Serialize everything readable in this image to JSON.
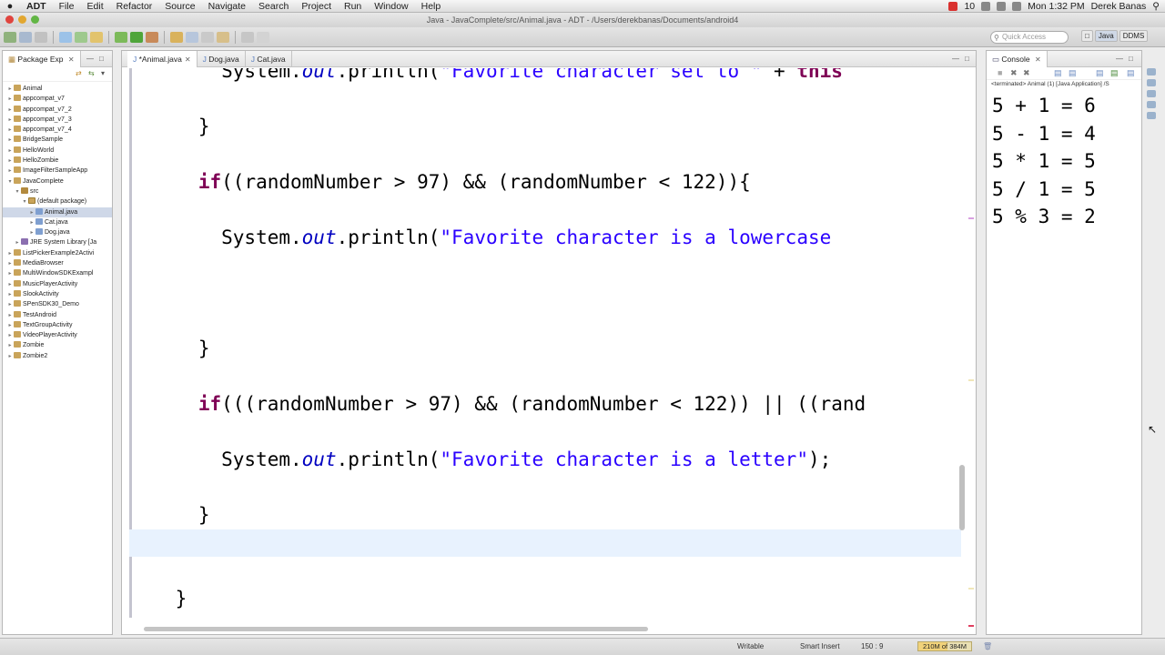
{
  "menubar": {
    "app": "ADT",
    "items": [
      "File",
      "Edit",
      "Refactor",
      "Source",
      "Navigate",
      "Search",
      "Project",
      "Run",
      "Window",
      "Help"
    ],
    "battery_count": "10",
    "clock": "Mon 1:32 PM",
    "user": "Derek Banas"
  },
  "window": {
    "title": "Java - JavaComplete/src/Animal.java - ADT - /Users/derekbanas/Documents/android4"
  },
  "toolbar": {
    "quick_access_placeholder": "Quick Access",
    "perspectives": [
      "Java",
      "DDMS"
    ]
  },
  "package_explorer": {
    "tab_label": "Package Exp",
    "tree": [
      {
        "label": "Animal",
        "type": "proj",
        "indent": 0,
        "twisty": "▸"
      },
      {
        "label": "appcompat_v7",
        "type": "proj",
        "indent": 0,
        "twisty": "▸"
      },
      {
        "label": "appcompat_v7_2",
        "type": "proj",
        "indent": 0,
        "twisty": "▸"
      },
      {
        "label": "appcompat_v7_3",
        "type": "proj",
        "indent": 0,
        "twisty": "▸"
      },
      {
        "label": "appcompat_v7_4",
        "type": "proj",
        "indent": 0,
        "twisty": "▸"
      },
      {
        "label": "BridgeSample",
        "type": "proj",
        "indent": 0,
        "twisty": "▸"
      },
      {
        "label": "HelloWorld",
        "type": "proj",
        "indent": 0,
        "twisty": "▸"
      },
      {
        "label": "HelloZombie",
        "type": "proj",
        "indent": 0,
        "twisty": "▸"
      },
      {
        "label": "ImageFilterSampleApp",
        "type": "proj",
        "indent": 0,
        "twisty": "▸"
      },
      {
        "label": "JavaComplete",
        "type": "proj",
        "indent": 0,
        "twisty": "▾"
      },
      {
        "label": "src",
        "type": "src",
        "indent": 1,
        "twisty": "▾"
      },
      {
        "label": "(default package)",
        "type": "pkgi",
        "indent": 2,
        "twisty": "▾"
      },
      {
        "label": "Animal.java",
        "type": "jfile",
        "indent": 3,
        "twisty": "▸",
        "selected": true
      },
      {
        "label": "Cat.java",
        "type": "jfile",
        "indent": 3,
        "twisty": "▸"
      },
      {
        "label": "Dog.java",
        "type": "jfile",
        "indent": 3,
        "twisty": "▸"
      },
      {
        "label": "JRE System Library [Ja",
        "type": "lib",
        "indent": 1,
        "twisty": "▸"
      },
      {
        "label": "ListPickerExample2Activi",
        "type": "proj",
        "indent": 0,
        "twisty": "▸"
      },
      {
        "label": "MediaBrowser",
        "type": "proj",
        "indent": 0,
        "twisty": "▸"
      },
      {
        "label": "MultiWindowSDKExampl",
        "type": "proj",
        "indent": 0,
        "twisty": "▸"
      },
      {
        "label": "MusicPlayerActivity",
        "type": "proj",
        "indent": 0,
        "twisty": "▸"
      },
      {
        "label": "SlookActivity",
        "type": "proj",
        "indent": 0,
        "twisty": "▸"
      },
      {
        "label": "SPenSDK30_Demo",
        "type": "proj",
        "indent": 0,
        "twisty": "▸"
      },
      {
        "label": "TestAndroid",
        "type": "proj",
        "indent": 0,
        "twisty": "▸"
      },
      {
        "label": "TextGroupActivity",
        "type": "proj",
        "indent": 0,
        "twisty": "▸"
      },
      {
        "label": "VideoPlayerActivity",
        "type": "proj",
        "indent": 0,
        "twisty": "▸"
      },
      {
        "label": "Zombie",
        "type": "proj",
        "indent": 0,
        "twisty": "▸"
      },
      {
        "label": "Zombie2",
        "type": "proj",
        "indent": 0,
        "twisty": "▸"
      }
    ]
  },
  "editor": {
    "tabs": [
      {
        "label": "*Animal.java",
        "active": true
      },
      {
        "label": "Dog.java",
        "active": false
      },
      {
        "label": "Cat.java",
        "active": false
      }
    ],
    "lines": [
      {
        "tokens": [
          [
            "",
            "        System."
          ],
          [
            "it",
            "out"
          ],
          [
            "",
            ".println("
          ],
          [
            "str",
            "\"Favorite character set to \""
          ],
          [
            "",
            " + "
          ],
          [
            "kw",
            "this"
          ]
        ]
      },
      {
        "tokens": [
          [
            "",
            "      }"
          ]
        ]
      },
      {
        "tokens": [
          [
            "",
            "      "
          ],
          [
            "kw",
            "if"
          ],
          [
            "",
            "((randomNumber > 97) && (randomNumber < 122)){"
          ]
        ]
      },
      {
        "tokens": [
          [
            "",
            "        System."
          ],
          [
            "it",
            "out"
          ],
          [
            "",
            ".println("
          ],
          [
            "str",
            "\"Favorite character is a lowercase"
          ]
        ]
      },
      {
        "tokens": []
      },
      {
        "tokens": [
          [
            "",
            "      }"
          ]
        ]
      },
      {
        "tokens": [
          [
            "",
            "      "
          ],
          [
            "kw",
            "if"
          ],
          [
            "",
            "(((randomNumber > 97) && (randomNumber < 122)) || ((rand"
          ]
        ]
      },
      {
        "tokens": [
          [
            "",
            "        System."
          ],
          [
            "it",
            "out"
          ],
          [
            "",
            ".println("
          ],
          [
            "str",
            "\"Favorite character is a letter\""
          ],
          [
            "",
            ");"
          ]
        ]
      },
      {
        "tokens": [
          [
            "",
            "      }"
          ]
        ]
      },
      {
        "tokens": [],
        "current": true
      },
      {
        "tokens": [
          [
            "",
            "    }"
          ]
        ]
      }
    ]
  },
  "console": {
    "tab_label": "Console",
    "status": "<terminated> Animal (1) [Java Application] /S",
    "output": [
      "5 + 1 = 6",
      "5 - 1 = 4",
      "5 * 1 = 5",
      "5 / 1 = 5",
      "5 % 3 = 2"
    ]
  },
  "statusbar": {
    "writable": "Writable",
    "insert_mode": "Smart Insert",
    "position": "150 : 9",
    "heap": "210M of 384M",
    "heap_used_fraction": 0.55
  },
  "colors": {
    "keyword": "#7f0055",
    "string": "#2a00ff",
    "field": "#0000c0",
    "current_line": "#e8f2fe"
  }
}
